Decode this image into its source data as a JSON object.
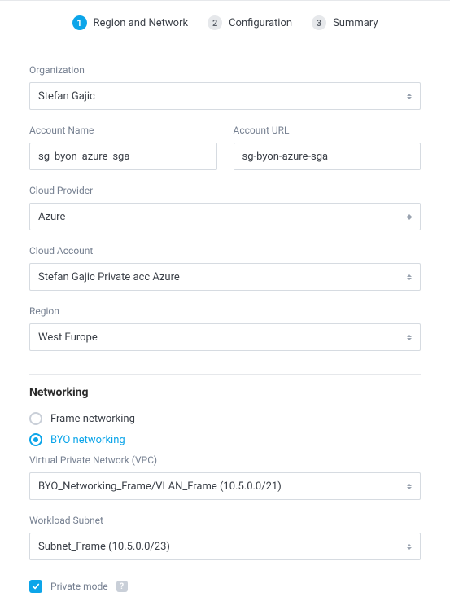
{
  "stepper": {
    "steps": [
      {
        "num": "1",
        "label": "Region and Network",
        "active": true
      },
      {
        "num": "2",
        "label": "Configuration",
        "active": false
      },
      {
        "num": "3",
        "label": "Summary",
        "active": false
      }
    ]
  },
  "form": {
    "organization": {
      "label": "Organization",
      "value": "Stefan Gajic"
    },
    "account_name": {
      "label": "Account Name",
      "value": "sg_byon_azure_sga"
    },
    "account_url": {
      "label": "Account URL",
      "value": "sg-byon-azure-sga"
    },
    "cloud_provider": {
      "label": "Cloud Provider",
      "value": "Azure"
    },
    "cloud_account": {
      "label": "Cloud Account",
      "value": "Stefan Gajic Private acc Azure"
    },
    "region": {
      "label": "Region",
      "value": "West Europe"
    }
  },
  "networking": {
    "title": "Networking",
    "options": {
      "frame": "Frame networking",
      "byo": "BYO networking"
    },
    "selected": "byo",
    "vpc": {
      "label": "Virtual Private Network (VPC)",
      "value": "BYO_Networking_Frame/VLAN_Frame (10.5.0.0/21)"
    },
    "workload_subnet": {
      "label": "Workload Subnet",
      "value": "Subnet_Frame (10.5.0.0/23)"
    },
    "private_mode": {
      "label": "Private mode",
      "checked": true
    }
  }
}
